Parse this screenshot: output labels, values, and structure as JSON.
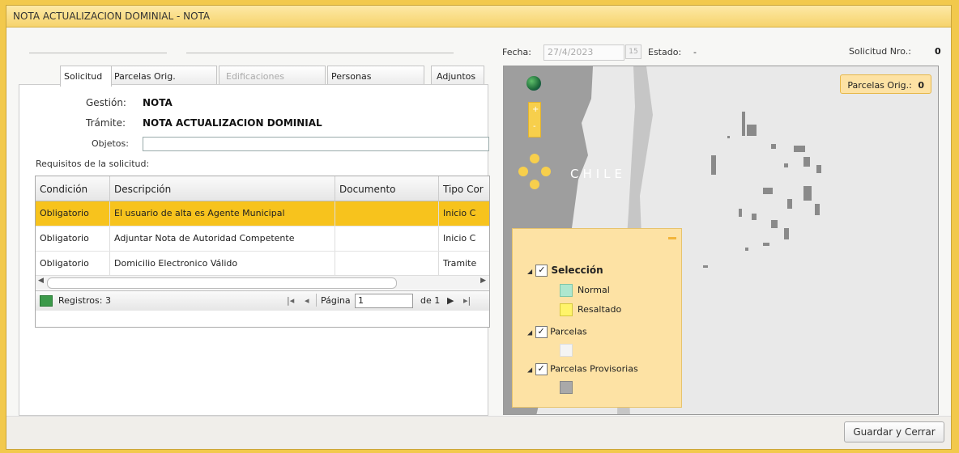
{
  "window": {
    "title": "NOTA ACTUALIZACION DOMINIAL  -  NOTA"
  },
  "header": {
    "fecha_label": "Fecha:",
    "fecha_value": "27/4/2023",
    "calendar_day": "15",
    "estado_label": "Estado:",
    "estado_value": "-",
    "solicitud_label": "Solicitud Nro.:",
    "solicitud_value": "0"
  },
  "tabs": [
    {
      "label": "Solicitud"
    },
    {
      "label": "Parcelas Orig."
    },
    {
      "label": "Edificaciones"
    },
    {
      "label": "Personas"
    },
    {
      "label": "Adjuntos"
    }
  ],
  "form": {
    "gestion_label": "Gestión:",
    "gestion_value": "NOTA",
    "tramite_label": "Trámite:",
    "tramite_value": "NOTA ACTUALIZACION DOMINIAL",
    "objetos_label": "Objetos:",
    "objetos_value": "",
    "requisitos_label": "Requisitos de la solicitud:"
  },
  "grid": {
    "columns": [
      "Condición",
      "Descripción",
      "Documento",
      "Tipo Cor"
    ],
    "rows": [
      [
        "Obligatorio",
        "El usuario de alta es Agente Municipal",
        "",
        "Inicio C"
      ],
      [
        "Obligatorio",
        "Adjuntar Nota de Autoridad Competente",
        "",
        "Inicio C"
      ],
      [
        "Obligatorio",
        "Domicilio Electronico Válido",
        "",
        "Tramite"
      ]
    ],
    "records_label": "Registros: 3",
    "page_label": "Página",
    "page_value": "1",
    "page_of": "de 1"
  },
  "map": {
    "country_label": "CHILE",
    "parcelas_badge_label": "Parcelas Orig.:",
    "parcelas_badge_value": "0",
    "zoom_in": "+",
    "zoom_out": "-",
    "legend": {
      "seleccion": "Selección",
      "normal": "Normal",
      "resaltado": "Resaltado",
      "parcelas": "Parcelas",
      "provisorias": "Parcelas Provisorias"
    }
  },
  "footer": {
    "save_close": "Guardar y Cerrar"
  }
}
